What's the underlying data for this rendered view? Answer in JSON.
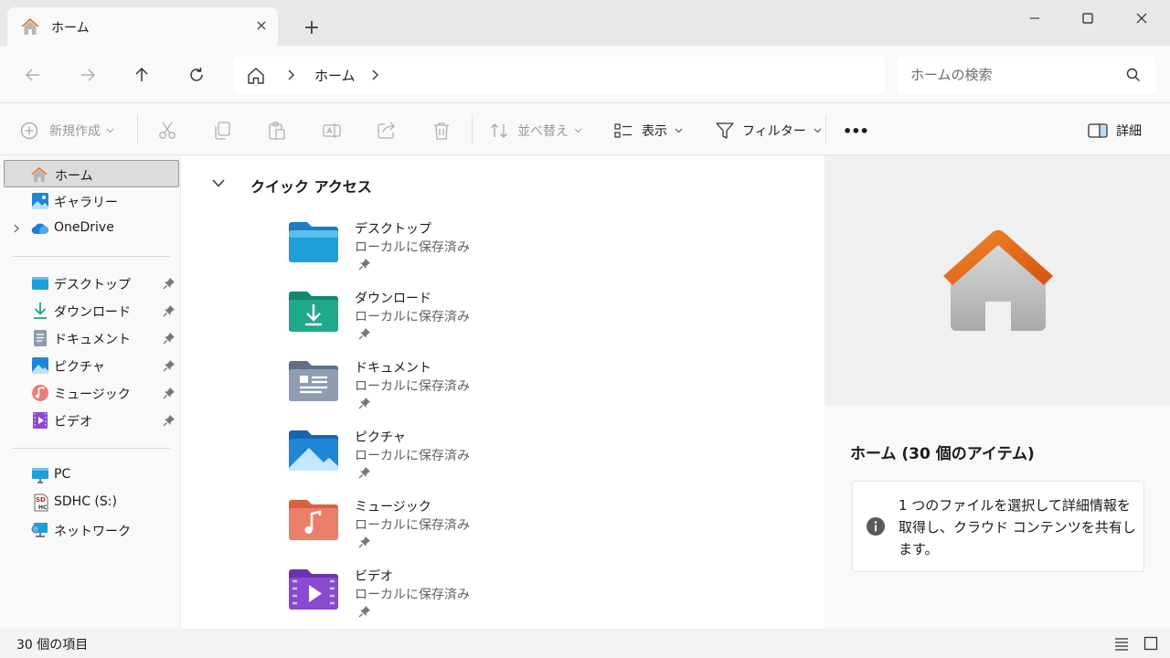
{
  "window": {
    "tab_title": "ホーム",
    "tab_icon": "home-icon",
    "close_tab": "×",
    "new_tab": "+"
  },
  "addressbar": {
    "breadcrumb": [
      "ホーム"
    ],
    "search_placeholder": "ホームの検索"
  },
  "commandbar": {
    "new": "新規作成",
    "sort": "並べ替え",
    "view": "表示",
    "filter": "フィルター",
    "more": "•••",
    "details": "詳細"
  },
  "sidebar": {
    "top_items": [
      {
        "label": "ホーム",
        "icon": "home-icon",
        "selected": true
      },
      {
        "label": "ギャラリー",
        "icon": "gallery-icon"
      },
      {
        "label": "OneDrive",
        "icon": "onedrive-icon",
        "expandable": true
      }
    ],
    "pinned_items": [
      {
        "label": "デスクトップ",
        "icon": "desktop-icon"
      },
      {
        "label": "ダウンロード",
        "icon": "download-icon"
      },
      {
        "label": "ドキュメント",
        "icon": "document-icon"
      },
      {
        "label": "ピクチャ",
        "icon": "pictures-icon"
      },
      {
        "label": "ミュージック",
        "icon": "music-icon"
      },
      {
        "label": "ビデオ",
        "icon": "video-icon"
      }
    ],
    "device_items": [
      {
        "label": "PC",
        "icon": "pc-icon"
      },
      {
        "label": "SDHC (S:)",
        "icon": "sd-card-icon"
      },
      {
        "label": "ネットワーク",
        "icon": "network-icon"
      }
    ]
  },
  "main": {
    "section_title": "クイック アクセス",
    "folders": [
      {
        "name": "デスクトップ",
        "status": "ローカルに保存済み",
        "icon": "desktop-folder-icon",
        "color": "#1f9fd8"
      },
      {
        "name": "ダウンロード",
        "status": "ローカルに保存済み",
        "icon": "download-folder-icon",
        "color": "#1fa88a"
      },
      {
        "name": "ドキュメント",
        "status": "ローカルに保存済み",
        "icon": "document-folder-icon",
        "color": "#7d8fa8"
      },
      {
        "name": "ピクチャ",
        "status": "ローカルに保存済み",
        "icon": "pictures-folder-icon",
        "color": "#1f86d8"
      },
      {
        "name": "ミュージック",
        "status": "ローカルに保存済み",
        "icon": "music-folder-icon",
        "color": "#e8664a"
      },
      {
        "name": "ビデオ",
        "status": "ローカルに保存済み",
        "icon": "video-folder-icon",
        "color": "#8a4ad0"
      }
    ]
  },
  "details": {
    "title": "ホーム (30 個のアイテム)",
    "info": "1 つのファイルを選択して詳細情報を取得し、クラウド コンテンツを共有します。"
  },
  "statusbar": {
    "item_count": "30 個の項目"
  },
  "colors": {
    "accent_orange": "#e8731f",
    "window_bg": "#f3f3f3"
  }
}
